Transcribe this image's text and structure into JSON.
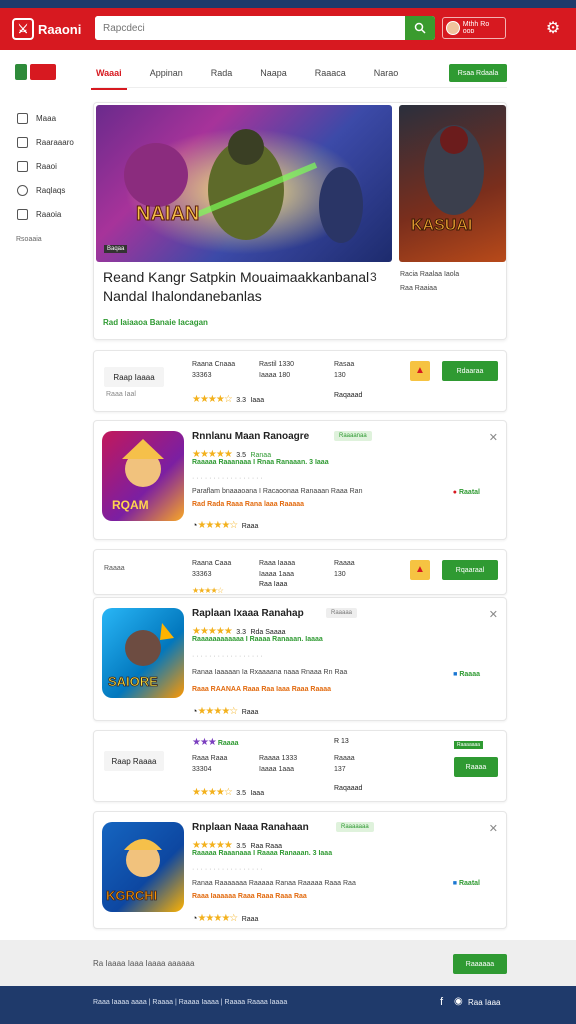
{
  "topbar": {
    "logo": "Rᴇᴀᴅ",
    "logo_text": "Raaoni",
    "search_placeholder": "Rapcdeci",
    "user_text": "Mthh Rᴏ ᴏᴏᴅ",
    "settings_icon": "gear-icon"
  },
  "sidebar": {
    "items": [
      {
        "label": "Maaa",
        "icon": "home-icon"
      },
      {
        "label": "Raaraaaro",
        "icon": "grid-icon"
      },
      {
        "label": "Raaoi",
        "icon": "book-icon"
      },
      {
        "label": "Raqlaqs",
        "icon": "tag-icon"
      },
      {
        "label": "Raaoia",
        "icon": "chat-icon"
      }
    ],
    "footer": "Rsoaaia"
  },
  "tabs": {
    "items": [
      "Waaai",
      "Appinan",
      "Rada",
      "Naapa",
      "Raaaca",
      "Narao"
    ],
    "active": 0,
    "button": "Rsaa Rdaala"
  },
  "hero": {
    "title_line1": "Reand Kangr Satpkin Mouaimaakkanbanal",
    "title_line2": "Nandal  Ihalondanebanlas",
    "number": "3",
    "subtitle": "Rad  Iaiaaoa Banaie Iacagan",
    "badge": "Baqaa",
    "side_label1": "Racia Raalaa Iaola",
    "side_label2": "Raa  Raaiaa"
  },
  "stats1": {
    "label": "Raap Iaaaa",
    "small": "Raaa Iaal",
    "col1": [
      "Raana Cnaaa",
      "33363"
    ],
    "col2": [
      "Rastil 1330",
      "Iaaaa 180"
    ],
    "col3": [
      "Rasaa",
      "130"
    ],
    "rating": "3.3",
    "rating_text": "Iaaa",
    "col3_bottom": "Raqaaad",
    "button": "Rdaaraa"
  },
  "game1": {
    "title": "Rnnlanu Maan  Ranoagre",
    "tag": "Raaaanaa",
    "rating": "3.5",
    "rating_text": "Ranaa",
    "line1": "Raaaaa Raaanaaa  I Rnaa Ranaaan.  3 Iaaa",
    "line2": "Paraflam  bnaaaoana I Racaoonaa Ranaaan  Raaa Ran",
    "line3": "Rad Rada Raaa  Rana laaa Raaaaa",
    "right": "Raatal",
    "bottom_rating": "Raaa"
  },
  "stats2": {
    "label": "Raaaa",
    "col1": [
      "Raana Caaa",
      "33363"
    ],
    "col2": [
      "Raaa Iaaaa",
      "Iaaaa 1aaa"
    ],
    "col3": [
      "Raaaa",
      "130"
    ],
    "rating_text": "Raa Iaaa",
    "button": "Rqaaraal"
  },
  "game2": {
    "title": "Raplaan  Ixaaa  Ranahap",
    "tag": "Raaaaa",
    "rating": "3.3",
    "rating_text": "Rda  Saaaa",
    "line1": "Raaaaaaaaaaaa  I Raaaa Ranaaan.  Iaaaa",
    "line2": "Ranaa  Iaaaaan  Ia Rxaaaana naaa  Rnaaa Rn Raa",
    "line3": "Raaa RAANAA  Raaa  Raa Iaaa Raaa Raaaa",
    "right": "Raaaa",
    "bottom_rating": "Raaa"
  },
  "stats3": {
    "label": "Raap Raaaa",
    "col1": [
      "Raaa Raaa",
      "33304"
    ],
    "col2": [
      "Raaaa 1333",
      "Iaaaa 1aaa"
    ],
    "col3": [
      "Raaaa",
      "137"
    ],
    "top_tag": "Raaaa",
    "rating": "3.5",
    "rating_text": "Iaaa",
    "col3_bottom": "Raqaaad",
    "button": "Raaaa",
    "top_right": "Raaaaaaa"
  },
  "game3": {
    "title": "Rnplaan Naaa  Ranahaan",
    "tag": "Raaaaaaa",
    "rating": "3.5",
    "rating_text": "Raa Raaa",
    "line1": "Raaaaa Raaanaaa  I Raaaa Ranaaan.  3 Iaaa",
    "line2": "Ranaa  Raaaaaaa  Raaaaa Ranaa Raaaaa Raaa Raa",
    "line3": "Raaa Iaaaaaa  Raaa  Raaa Raaa Raa",
    "right": "Raatal",
    "bottom_rating": "Raaa"
  },
  "footer": {
    "text": "Ra Iaaaa Iaaa Iaaaa aaaaaa",
    "button": "Raaaaaa",
    "links": "Raaa  Iaaaa aaaa  |  Raaaa  |  Raaaa  Iaaaa  |  Raaaa  Raaaa Iaaaa",
    "brand": "Raa Iaaa"
  },
  "colors": {
    "brand": "#d71920",
    "accent": "#2f9a32",
    "navy": "#1f3a6b"
  }
}
